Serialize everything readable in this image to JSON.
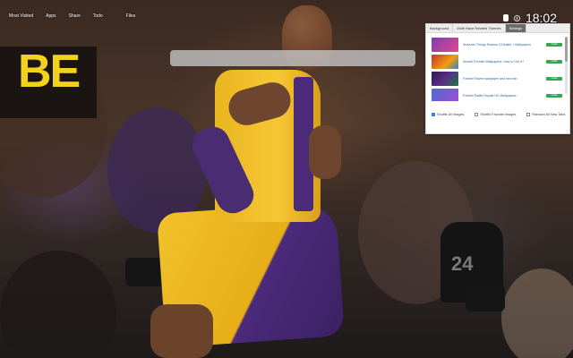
{
  "topnav": {
    "links": [
      "Most Visited",
      "Apps",
      "Share",
      "Todo",
      "Files"
    ]
  },
  "clock": {
    "time": "18:02"
  },
  "search": {
    "placeholder": ""
  },
  "background": {
    "sign_text": "BE",
    "shirt_number": "24"
  },
  "panel": {
    "tabs": [
      "Background",
      "Multi Have Related Themes",
      "Settings"
    ],
    "active_tab": 2,
    "items": [
      {
        "title": "Snazzier Things Season 3-Details + Wallpapers",
        "button": "Install",
        "thumb_color": "#7a3fb0"
      },
      {
        "title": "Sunset Fortnite Wallpapers: How to Get It?",
        "button": "Install",
        "thumb_color": "#c0392b"
      },
      {
        "title": "Fortnite Raven wallpaper and new tab",
        "button": "Install",
        "thumb_color": "#2b1a4a"
      },
      {
        "title": "Fortnite Battle Royale HD Wallpapers",
        "button": "Install",
        "thumb_color": "#4a6fd0"
      }
    ],
    "options": [
      {
        "label": "Shuffle All Images",
        "checked": true
      },
      {
        "label": "Shuffle Favorite Images",
        "checked": false
      },
      {
        "label": "Random All New Tabs",
        "checked": false
      }
    ]
  },
  "colors": {
    "accent": "#2fa84f",
    "link": "#3465a4",
    "jersey_gold": "#f6c734",
    "jersey_purple": "#4b2a7a"
  }
}
